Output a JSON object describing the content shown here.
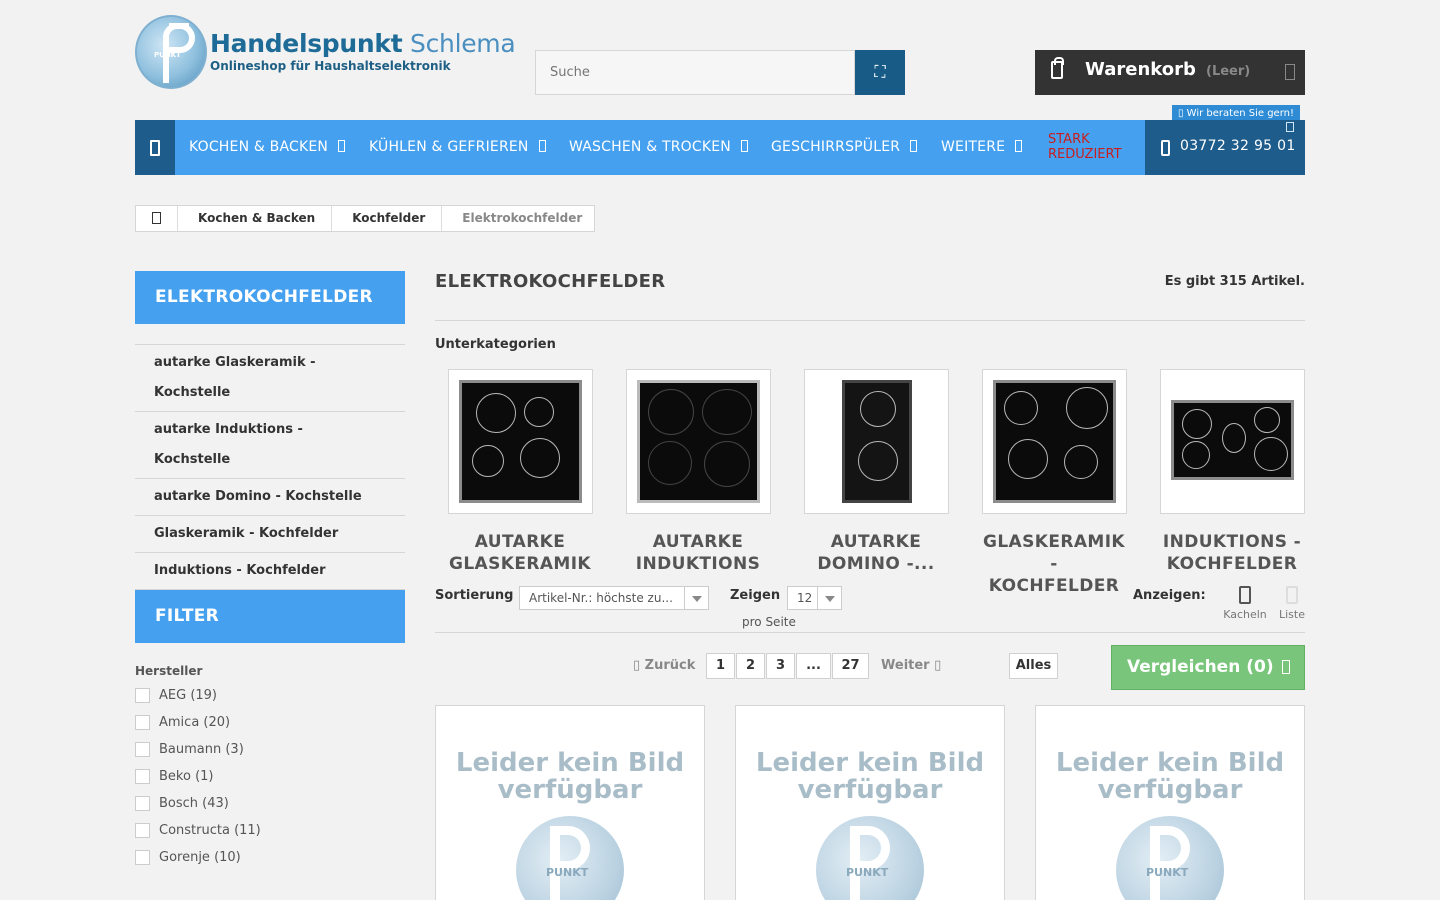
{
  "header": {
    "logo_title_bold": "Handelspunkt",
    "logo_title_light": " Schlema",
    "logo_subtitle": "Onlineshop für Haushaltselektronik",
    "logo_mark_text": "PUNKT",
    "search_placeholder": "Suche",
    "cart_label": "Warenkorb",
    "cart_state": "(Leer)"
  },
  "nav": {
    "advise_label": "▯ Wir beraten Sie gern!",
    "items": [
      {
        "label": "KOCHEN & BACKEN"
      },
      {
        "label": "KÜHLEN & GEFRIEREN"
      },
      {
        "label": "WASCHEN & TROCKEN"
      },
      {
        "label": "GESCHIRRSPÜLER"
      },
      {
        "label": "WEITERE"
      }
    ],
    "sale_line1": "STARK",
    "sale_line2": "REDUZIERT",
    "phone": "03772 32 95 01"
  },
  "breadcrumb": [
    "Kochen & Backen",
    "Kochfelder",
    "Elektrokochfelder"
  ],
  "sidebar": {
    "category_title": "ELEKTROKOCHFELDER",
    "subcategories": [
      {
        "line1": "autarke Glaskeramik -",
        "line2": "Kochstelle"
      },
      {
        "line1": "autarke Induktions -",
        "line2": "Kochstelle"
      },
      {
        "line1": "autarke Domino - Kochstelle",
        "line2": ""
      },
      {
        "line1": "Glaskeramik - Kochfelder",
        "line2": ""
      },
      {
        "line1": "Induktions - Kochfelder",
        "line2": ""
      }
    ],
    "filter_title": "FILTER",
    "filter_group": "Hersteller",
    "manufacturers": [
      "AEG (19)",
      "Amica (20)",
      "Baumann (3)",
      "Beko (1)",
      "Bosch (43)",
      "Constructa (11)",
      "Gorenje (10)"
    ]
  },
  "main": {
    "title": "ELEKTROKOCHFELDER",
    "count": "Es gibt 315 Artikel.",
    "subcategories_label": "Unterkategorien",
    "subcategory_cards": [
      {
        "line1": "AUTARKE",
        "line2": "GLASKERAMIK",
        "line3": ""
      },
      {
        "line1": "AUTARKE",
        "line2": "INDUKTIONS",
        "line3": ""
      },
      {
        "line1": "AUTARKE",
        "line2": "DOMINO -...",
        "line3": ""
      },
      {
        "line1": "GLASKERAMIK",
        "line2": "-",
        "line3": "KOCHFELDER"
      },
      {
        "line1": "INDUKTIONS -",
        "line2": "KOCHFELDER",
        "line3": ""
      }
    ],
    "sort_label": "Sortierung",
    "sort_value": "Artikel-Nr.: höchste zu...",
    "show_label": "Zeigen",
    "show_value": "12",
    "per_page": "pro Seite",
    "view_label": "Anzeigen:",
    "view_grid": "Kacheln",
    "view_list": "Liste",
    "pagination": {
      "prev": "▯ Zurück",
      "pages": [
        "1",
        "2",
        "3",
        "...",
        "27"
      ],
      "next": "Weiter ▯"
    },
    "all_label": "Alles",
    "compare_label": "Vergleichen (0)",
    "products": [
      {
        "no_image_line1": "Leider kein Bild",
        "no_image_line2": "verfügbar"
      },
      {
        "no_image_line1": "Leider kein Bild",
        "no_image_line2": "verfügbar"
      },
      {
        "no_image_line1": "Leider kein Bild",
        "no_image_line2": "verfügbar"
      }
    ]
  },
  "colors": {
    "nav_blue": "#45a1f0",
    "nav_dark": "#1d5c8b",
    "cart_dark": "#333333",
    "sale_red": "#c81e1e",
    "compare_green": "#79c57b"
  }
}
